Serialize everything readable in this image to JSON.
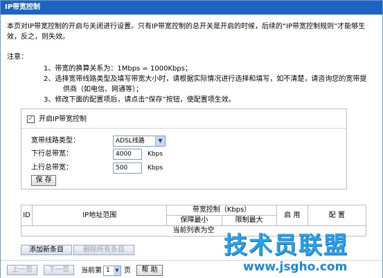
{
  "window": {
    "title": "IP带宽控制"
  },
  "intro": "本页对IP带宽控制的开启与关闭进行设置。只有IP带宽控制的总开关是开启的时候，后续的“IP带宽控制规则”才能够生效，反之，则失效。",
  "notes": {
    "title": "注意：",
    "items": [
      "1、带宽的换算关系为：1Mbps = 1000Kbps；",
      "2、选择宽带线路类型及填写带宽大小时，请根据实际情况进行选择和填写，如不清楚，请咨询您的宽带提",
      "供商（如电信、网通等）；",
      "3、修改下面的配置项后，请点击“保存”按钮，使配置项生效。"
    ]
  },
  "form": {
    "enable_label": "开启IP带宽控制",
    "enable_checked": true,
    "line_type_label": "宽带线路类型：",
    "line_type_value": "ADSL线路",
    "down_label": "下行总带宽：",
    "down_value": "4000",
    "up_label": "上行总带宽：",
    "up_value": "500",
    "unit": "Kbps",
    "save_label": "保 存"
  },
  "table": {
    "col_id": "ID",
    "col_ip": "IP地址范围",
    "col_bw": "带宽控制（Kbps）",
    "col_min": "保障最小",
    "col_max": "限制最大",
    "col_enable": "启 用",
    "col_config": "配 置",
    "empty_text": "当前列表为空"
  },
  "actions": {
    "add_label": "添加新条目",
    "delete_all_label": "删除所有条目"
  },
  "pager": {
    "prev_label": "上一页",
    "next_label": "下一页",
    "current_prefix": "当前第",
    "current_page": "1",
    "current_suffix": "页",
    "help_label": "帮 助"
  },
  "watermark": {
    "text": "技术员联盟",
    "url": "www.jsgho.com"
  }
}
